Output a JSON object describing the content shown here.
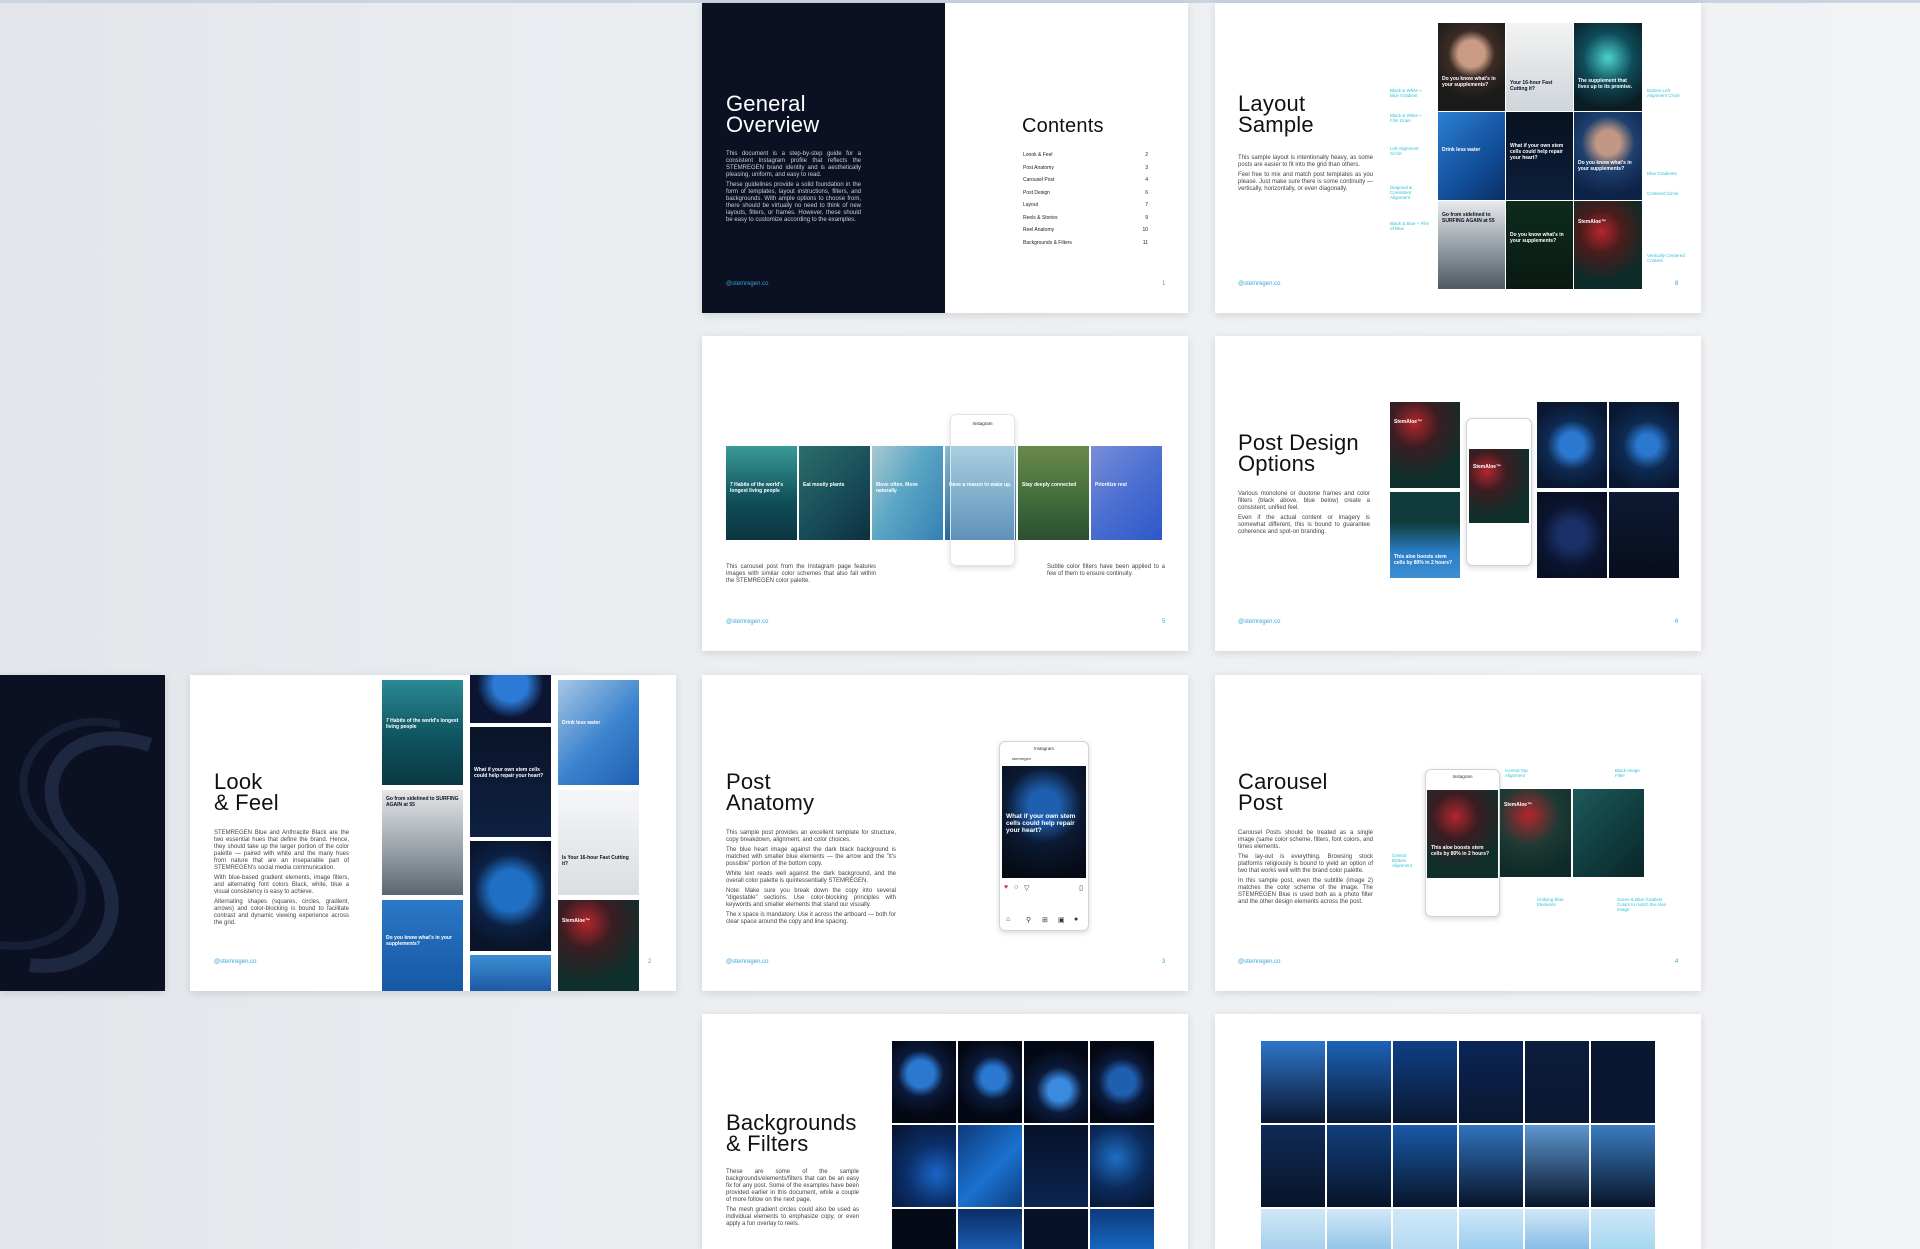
{
  "colors": {
    "dark": "#0b1122",
    "accent": "#3aa3d6",
    "annotation": "#2fc2d6",
    "tile_blue": "#1f6fc4"
  },
  "handle": "@stemregen.co",
  "general": {
    "title_line1": "General",
    "title_line2": "Overview",
    "body": [
      "This document is a step-by-step guide for a consistent Instagram profile that reflects the STEMREGEN brand identity and is aesthetically pleasing, uniform, and easy to read.",
      "These guidelines provide a solid foundation in the form of templates, layout instructions, filters, and backgrounds. With ample options to choose from, there should be virtually no need to think of new layouts, filters, or frames. However, these should be easy to customize according to the examples."
    ],
    "page": "1"
  },
  "contents": {
    "title": "Contents",
    "items": [
      {
        "label": "Loook & Feel",
        "page": "2"
      },
      {
        "label": "Post Anatomy",
        "page": "3"
      },
      {
        "label": "Carousel Post",
        "page": "4"
      },
      {
        "label": "Post Design",
        "page": "6"
      },
      {
        "label": "Layout",
        "page": "7"
      },
      {
        "label": "Reels & Stories",
        "page": "9"
      },
      {
        "label": "Reel Anatomy",
        "page": "10"
      },
      {
        "label": "Backgrounds & Filters",
        "page": "11"
      }
    ]
  },
  "layout": {
    "title_line1": "Layout",
    "title_line2": "Sample",
    "body": [
      "This sample layout is intentionally heavy, as some posts are easier to fit into the grid than others.",
      "Feel free to mix and match post templates as you please. Just make sure there is some continuity — vertically, horizontally, or even diagonally."
    ],
    "page": "8",
    "tiles": [
      "Do you know what's in your supplements?",
      "Your 16-hour Fast Cutting it?",
      "The supplement that lives up to its promise.",
      "Drink less water",
      "What if your own stem cells could help repair your heart?",
      "Do you know what's in your supplements?",
      "Go from sidelined to SURFING AGAIN at 55",
      "Do you know what's in your supplements?",
      "StemAloe™"
    ],
    "annotations_left": [
      "Black & White + Blue Gradient",
      "Black & White + Film Grain",
      "Left Alignment Circle",
      "Diagonal & Consistent Alignment",
      "Black & Blue + Film of Blue"
    ],
    "annotations_right": [
      "Bottom Left Alignment Circle",
      "Blue Gradients",
      "Centered Circle",
      "Vertically Centered Content"
    ]
  },
  "carousel_strip": {
    "tiles": [
      "7 Habits of the world's longest living people",
      "Eat mostly plants",
      "Move often. Move naturally",
      "Have a reason to wake up.",
      "Stay deeply connected",
      "Prioritize rest"
    ],
    "caption_left": "This carousel post from the Instagram page features images with similar color schemes that also fall within the STEMREGEN color palette.",
    "caption_right": "Subtle color filters have been applied to a few of them to ensure continuity.",
    "page": "5",
    "phone_label": "Instagram"
  },
  "post_design": {
    "title_line1": "Post Design",
    "title_line2": "Options",
    "body": [
      "Various monotone or duotone frames and color filters (black above, blue below) create a consistent, unified feel.",
      "Even if the actual content or imagery is somewhat different, this is bound to guarantee coherence and spot-on branding."
    ],
    "page": "6",
    "tiles": [
      "StemAloe™",
      "This aloe boosts stem cells by 80% in 2 hours?",
      "StemAloe™"
    ]
  },
  "look": {
    "title_line1": "Look",
    "title_line2": "& Feel",
    "body": [
      "STEMREGEN Blue and Anthracite Black are the two essential hues that define the brand. Hence, they should take up the larger portion of the color palette — paired with white and the many hues from nature that are an inseparable part of STEMREGEN's social media communication.",
      "With blue-based gradient elements, image filters, and alternating font colors Black, white, blue a visual consistency is easy to achieve.",
      "Alternating shapes (squares, circles, gradient, arrows) and color-blocking is bound to facilitate contrast and dynamic viewing experience across the grid."
    ],
    "page": "2",
    "tiles": [
      "7 Habits of the world's longest living people",
      "What if your own stem cells could help repair your heart?",
      "Drink less water",
      "Go from sidelined to SURFING AGAIN at 55",
      "Is Your 16-hour Fast Cutting it?",
      "Do you know what's in your supplements?",
      "StemAloe™"
    ]
  },
  "anatomy": {
    "title_line1": "Post",
    "title_line2": "Anatomy",
    "body": [
      "This sample post provides an excellent template for structure, copy breakdown, alignment, and color choices.",
      "The blue heart image against the dark black background is matched with smaller blue elements — the arrow and the \"it's possible\" portion of the bottom copy.",
      "White text reads well against the dark background, and the overall color palette is quintessentially STEMREGEN.",
      "Note: Make sure you break down the copy into several \"digestable\" sections. Use color-blocking principles with keywords and smaller elements that stand our visually.",
      "The x space is mandatory. Use it across the artboard — both for clear space around the copy and line spacing."
    ],
    "page": "3",
    "phone_label": "Instagram",
    "account": "stemregen",
    "post_text": "What if your own stem cells could help repair your heart?"
  },
  "carousel": {
    "title_line1": "Carousel",
    "title_line2": "Post",
    "body": [
      "Carousel Posts should be treated as a single image (same color scheme, filters, font colors, and times elements.",
      "The lay-out is everything. Browsing stock platforms religiously is bound to yield an option of two that works well with the brand color palette.",
      "In this sample post, even the subtitle (image 2) matches the color scheme of the image. The STEMREGEN Blue is used both as a photo filter and the other design elements across the post."
    ],
    "page": "4",
    "phone_label": "Instagram",
    "annotations": [
      "Central Top Alignment",
      "Black Image Filter",
      "Central Bottom Alignment",
      "Unifying Blue Elements",
      "Green & Blue Gradient Colors to match the Aloe Image"
    ],
    "tiles": [
      "This aloe boosts stem cells by 80% in 2 hours?",
      "StemAloe™"
    ]
  },
  "backgrounds": {
    "title_line1": "Backgrounds",
    "title_line2": "& Filters",
    "body": [
      "These are some of the sample backgrounds/elements/filters that can be an easy fix for any post. Some of the examples have been provided earlier in this document, while a couple of more follow on the next page.",
      "The mesh gradient circles could also be used as individual elements to emphasize copy, or even apply a fun overlay to reels."
    ]
  },
  "swatches": [
    "#2f76c9",
    "#1c63b8",
    "#0f3f86",
    "#0a2556",
    "#0b1d3d",
    "#0a1730",
    "#0f2b56",
    "#113f7c",
    "#1a5aa8",
    "#3173be",
    "#5e97d0",
    "#3a7cc0",
    "#7fb5e4",
    "#5aa0dc",
    "#9ccdef",
    "#69b1e6",
    "#3d8fd4",
    "#7bc6e8"
  ]
}
